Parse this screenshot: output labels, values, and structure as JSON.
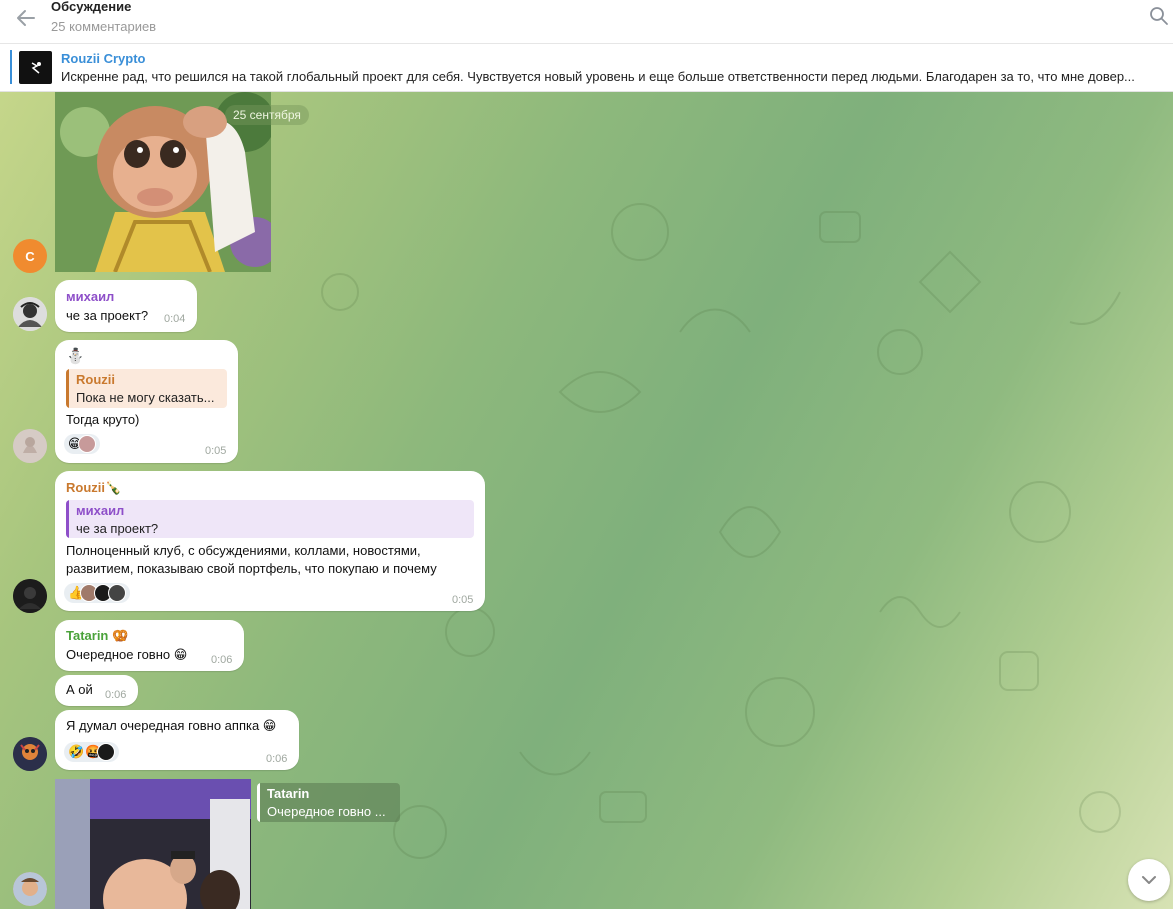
{
  "header": {
    "title": "Обсуждение",
    "subtitle": "25 комментариев"
  },
  "pinned": {
    "name": "Rouzii Crypto",
    "text": "Искренне рад, что решился на такой глобальный проект для себя.  Чувствуется новый уровень и еще больше ответственности перед людьми.  Благодарен за то, что мне довер..."
  },
  "date_chip": "25 сентября",
  "avatars": {
    "c_letter": "C"
  },
  "messages": {
    "m1": {
      "sender": "михаил",
      "text": "че за проект?",
      "time": "0:04"
    },
    "m2": {
      "sender_emoji": "⛄",
      "reply_name": "Rouzii",
      "reply_text": "Пока не могу сказать...",
      "text": "Тогда круто)",
      "reaction": "😁",
      "time": "0:05"
    },
    "m3": {
      "sender": "Rouzii",
      "sender_emoji": "🍾",
      "reply_name": "михаил",
      "reply_text": "че за проект?",
      "line1": "Полноценный клуб, с обсуждениями, коллами, новостями,",
      "line2": "развитием, показываю свой портфель, что покупаю и почему",
      "reaction": "👍",
      "time": "0:05"
    },
    "m4": {
      "sender": "Tatarin",
      "sender_emoji": "🥨",
      "text": "Очередное говно 😁",
      "time": "0:06"
    },
    "m5": {
      "text": "А ой",
      "time": "0:06"
    },
    "m6": {
      "text": "Я думал очередная говно аппка 😁",
      "reaction1": "🤣",
      "reaction2": "🤬",
      "time": "0:06"
    },
    "m7": {
      "reply_name": "Tatarin",
      "reply_text": "Очередное говно ..."
    }
  },
  "colors": {
    "accent": "#3a8fd8",
    "mikhail": "#8e4fc9",
    "rouzii": "#c9792e",
    "tatarin": "#4aa23a"
  }
}
